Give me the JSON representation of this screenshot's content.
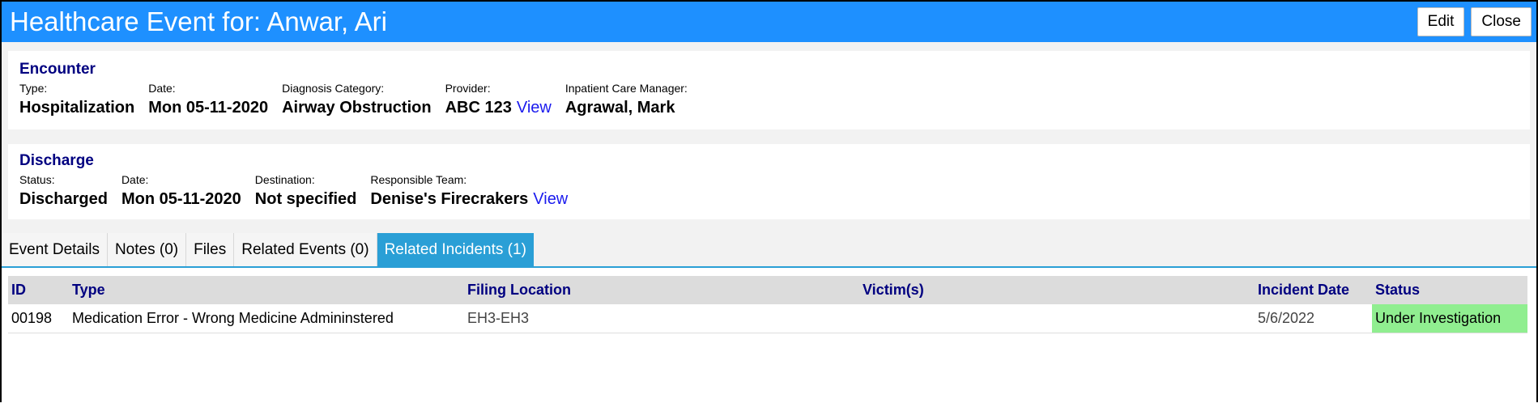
{
  "header": {
    "title": "Healthcare Event for: Anwar, Ari",
    "edit_label": "Edit",
    "close_label": "Close"
  },
  "encounter": {
    "title": "Encounter",
    "fields": [
      {
        "label": "Type:",
        "value": "Hospitalization"
      },
      {
        "label": "Date:",
        "value": "Mon 05-11-2020"
      },
      {
        "label": "Diagnosis Category:",
        "value": "Airway Obstruction"
      },
      {
        "label": "Provider:",
        "value": "ABC 123",
        "link": "View"
      },
      {
        "label": "Inpatient Care Manager:",
        "value": "Agrawal, Mark"
      }
    ]
  },
  "discharge": {
    "title": "Discharge",
    "fields": [
      {
        "label": "Status:",
        "value": "Discharged"
      },
      {
        "label": "Date:",
        "value": "Mon 05-11-2020"
      },
      {
        "label": "Destination:",
        "value": "Not specified"
      },
      {
        "label": "Responsible Team:",
        "value": "Denise's Firecrakers",
        "link": "View"
      }
    ]
  },
  "tabs": [
    "Event Details",
    "Notes (0)",
    "Files",
    "Related Events (0)",
    "Related Incidents (1)"
  ],
  "active_tab": "Related Incidents (1)",
  "incidents": {
    "columns": [
      "ID",
      "Type",
      "Filing Location",
      "Victim(s)",
      "Incident Date",
      "Status"
    ],
    "rows": [
      {
        "id": "00198",
        "type": "Medication Error - Wrong Medicine Admininstered",
        "filing_location": "EH3-EH3",
        "victims": "",
        "incident_date": "5/6/2022",
        "status": "Under Investigation"
      }
    ]
  },
  "colors": {
    "header_bg": "#1e90ff",
    "tab_active": "#2a9fd6",
    "section_title": "#000080",
    "link": "#1a1aee",
    "status_bg": "#90ee90"
  }
}
